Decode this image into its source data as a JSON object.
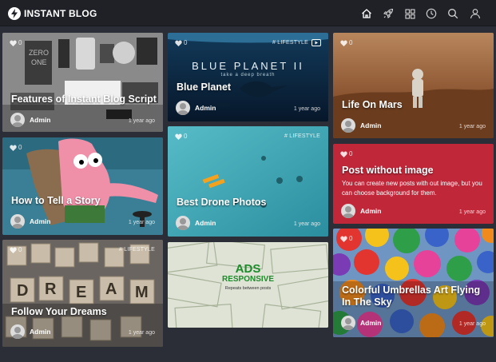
{
  "header": {
    "brand": "INSTANT BLOG",
    "nav_icons": [
      "home-icon",
      "rocket-icon",
      "grid-icon",
      "clock-icon",
      "search-icon",
      "user-icon"
    ]
  },
  "posts": [
    {
      "title": "Features of Instant Blog Script",
      "likes": "0",
      "author": "Admin",
      "time": "1 year ago",
      "tag": ""
    },
    {
      "title": "How to Tell a Story",
      "likes": "0",
      "author": "Admin",
      "time": "1 year ago",
      "tag": ""
    },
    {
      "title": "Follow Your Dreams",
      "likes": "0",
      "author": "Admin",
      "time": "1 year ago",
      "tag": "# LIFESTYLE"
    },
    {
      "title": "Blue Planet",
      "likes": "0",
      "author": "Admin",
      "time": "1 year ago",
      "tag": "# LIFESTYLE",
      "overlay_title": "BLUE PLANET II",
      "overlay_sub": "take a deep breath"
    },
    {
      "title": "Best Drone Photos",
      "likes": "0",
      "author": "Admin",
      "time": "1 year ago",
      "tag": "# LIFESTYLE"
    },
    {
      "title": "Life On Mars",
      "likes": "0",
      "author": "Admin",
      "time": "1 year ago",
      "tag": ""
    },
    {
      "title": "Post without image",
      "likes": "0",
      "author": "Admin",
      "time": "1 year ago",
      "tag": "",
      "excerpt": "You can create new posts with out image, but you can choose background for them."
    },
    {
      "title": "Colorful Umbrellas Art Flying In The Sky",
      "likes": "0",
      "author": "Admin",
      "time": "1 year ago",
      "tag": ""
    }
  ],
  "ad": {
    "line1": "ADS",
    "line2": "RESPONSIVE",
    "line3": "Repeats between posts"
  },
  "colors": {
    "header_bg": "#1f2127",
    "page_bg": "#2b2e36",
    "no_image_post": "#c0283a",
    "ad_green": "#1c8c2a"
  }
}
